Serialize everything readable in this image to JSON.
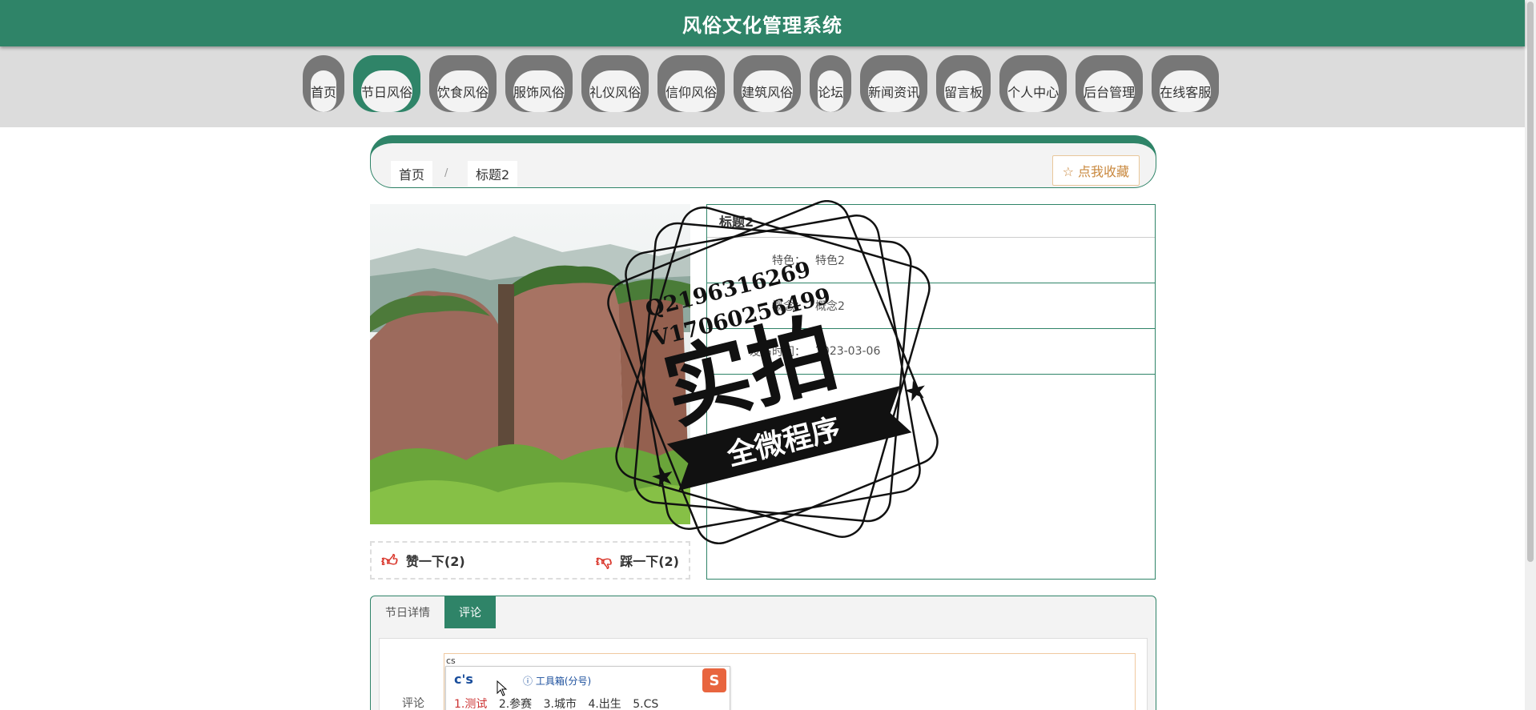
{
  "header": {
    "title": "风俗文化管理系统"
  },
  "nav": {
    "items": [
      {
        "label": "首页",
        "active": false
      },
      {
        "label": "节日风俗",
        "active": true
      },
      {
        "label": "饮食风俗",
        "active": false
      },
      {
        "label": "服饰风俗",
        "active": false
      },
      {
        "label": "礼仪风俗",
        "active": false
      },
      {
        "label": "信仰风俗",
        "active": false
      },
      {
        "label": "建筑风俗",
        "active": false
      },
      {
        "label": "论坛",
        "active": false
      },
      {
        "label": "新闻资讯",
        "active": false
      },
      {
        "label": "留言板",
        "active": false
      },
      {
        "label": "个人中心",
        "active": false
      },
      {
        "label": "后台管理",
        "active": false
      },
      {
        "label": "在线客服",
        "active": false
      }
    ]
  },
  "breadcrumb": {
    "home": "首页",
    "separator": "/",
    "current": "标题2"
  },
  "favorite_label": "☆ 点我收藏",
  "votes": {
    "like": "赞一下(2)",
    "dislike": "踩一下(2)"
  },
  "info": {
    "title": "标题2",
    "rows": [
      {
        "key": "特色：",
        "value": "特色2"
      },
      {
        "key": "概念：",
        "value": "概念2"
      },
      {
        "key": "发布时间：",
        "value": "2023-03-06"
      }
    ]
  },
  "stamp": {
    "line1": "Q2196316269",
    "line2": "V17060256499",
    "main": "实拍",
    "banner": "全微程序"
  },
  "tabs": [
    {
      "label": "节日详情",
      "active": false
    },
    {
      "label": "评论",
      "active": true
    }
  ],
  "comment": {
    "label": "评论"
  },
  "ime": {
    "typed": "cs",
    "composition": "c's",
    "toolbox": "工具箱(分号)",
    "candidates": [
      "1.测试",
      "2.参赛",
      "3.城市",
      "4.出生",
      "5.CS"
    ],
    "logo": "S"
  },
  "colors": {
    "primary": "#2f8468",
    "nav_bg": "#dcdcdc",
    "accent": "#c9883e"
  }
}
